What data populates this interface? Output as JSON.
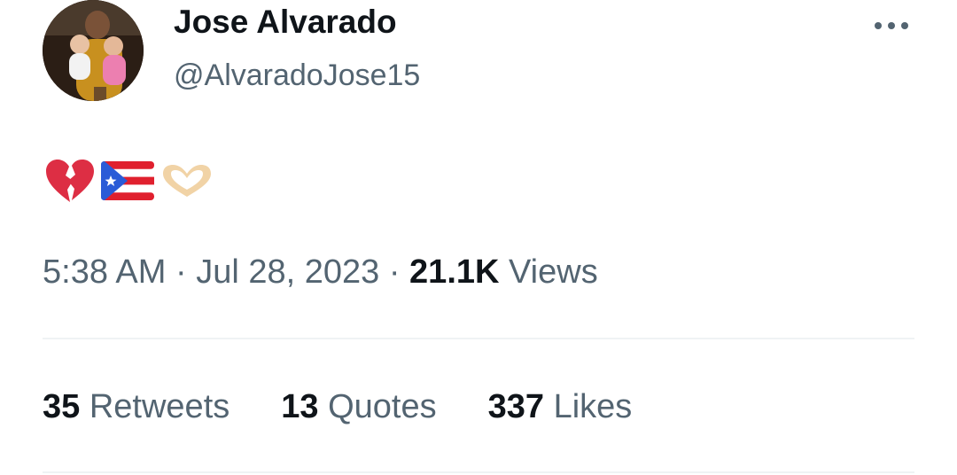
{
  "author": {
    "name": "Jose Alvarado",
    "handle": "@AlvaradoJose15"
  },
  "tweet": {
    "emojis": [
      "broken-heart",
      "puerto-rico-flag",
      "heart-hands"
    ],
    "text": "💔🇵🇷🫶",
    "time": "5:38 AM",
    "date": "Jul 28, 2023",
    "views_count": "21.1K",
    "views_label": "Views"
  },
  "stats": {
    "retweets_count": "35",
    "retweets_label": "Retweets",
    "quotes_count": "13",
    "quotes_label": "Quotes",
    "likes_count": "337",
    "likes_label": "Likes"
  },
  "colors": {
    "text_primary": "#0f1419",
    "text_secondary": "#536471",
    "divider": "#eff3f4",
    "background": "#ffffff"
  }
}
